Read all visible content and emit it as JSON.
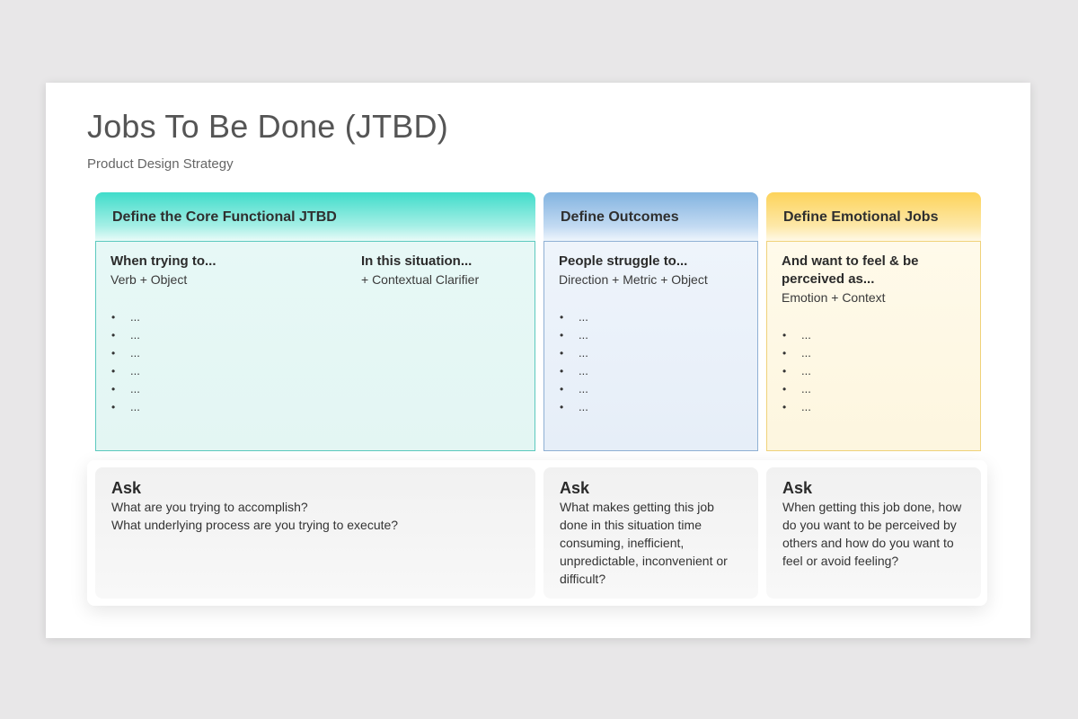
{
  "slide": {
    "title": "Jobs To Be Done (JTBD)",
    "subtitle": "Product Design Strategy"
  },
  "columns": [
    {
      "header": "Define the Core Functional JTBD",
      "color": "#3fdcca",
      "subsections": [
        {
          "heading": "When trying to...",
          "description": "Verb + Object",
          "bullets": [
            "...",
            "...",
            "...",
            "...",
            "...",
            "..."
          ]
        },
        {
          "heading": "In this situation...",
          "description": "+ Contextual Clarifier"
        }
      ],
      "ask": {
        "title": "Ask",
        "text": "What are you trying to accomplish?\nWhat underlying process are you trying to execute?"
      }
    },
    {
      "header": "Define Outcomes",
      "color": "#82b3e0",
      "subsections": [
        {
          "heading": "People struggle to...",
          "description": "Direction + Metric + Object",
          "bullets": [
            "...",
            "...",
            "...",
            "...",
            "...",
            "..."
          ]
        }
      ],
      "ask": {
        "title": "Ask",
        "text": "What makes getting this job\ndone in this situation time\nconsuming, inefficient,\nunpredictable, inconvenient or\ndifficult?"
      }
    },
    {
      "header": "Define Emotional Jobs",
      "color": "#fdd35a",
      "subsections": [
        {
          "heading": "And want to feel & be perceived as...",
          "description": "Emotion + Context",
          "bullets": [
            "...",
            "...",
            "...",
            "...",
            "..."
          ]
        }
      ],
      "ask": {
        "title": "Ask",
        "text": "When getting this job done, how\ndo you want to be perceived by\nothers and how do you want to\nfeel or avoid feeling?"
      }
    }
  ]
}
